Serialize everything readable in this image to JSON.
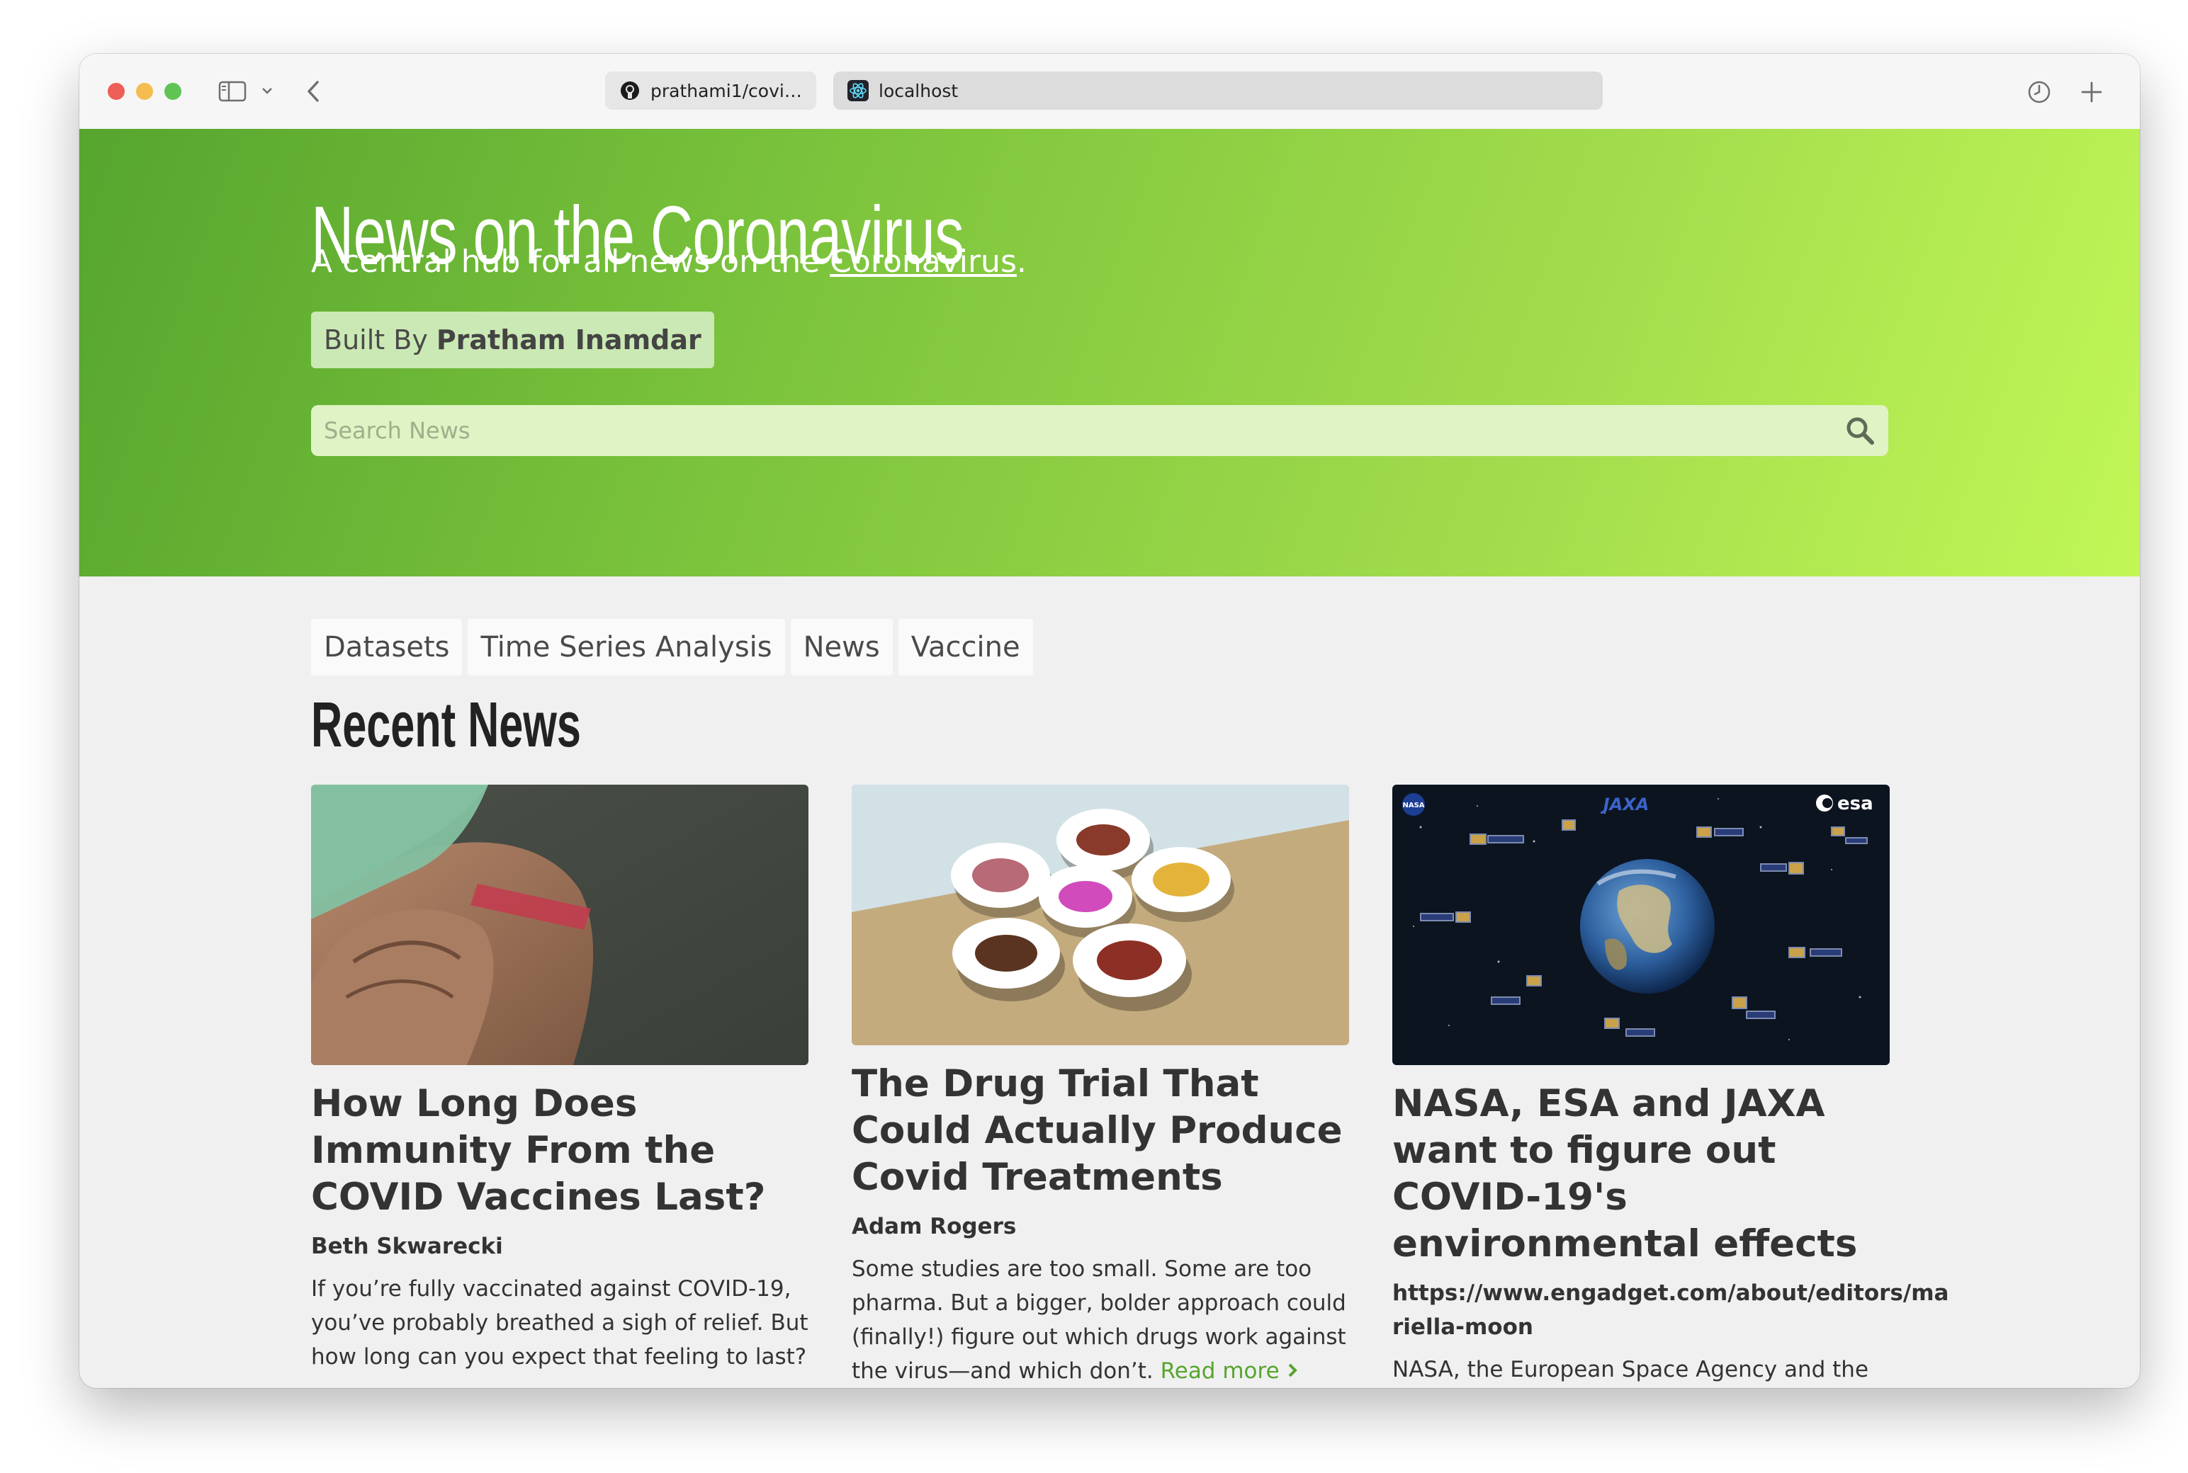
{
  "browser": {
    "tabs": [
      {
        "title": "prathami1/covid-...",
        "favicon": "github-icon"
      },
      {
        "title": "localhost",
        "favicon": "react-icon"
      }
    ]
  },
  "hero": {
    "title": "News on the Coronavirus",
    "subtitle_prefix": "A central hub for all news on the ",
    "subtitle_link": "Coronavirus",
    "subtitle_suffix": ".",
    "built_by_label": "Built By",
    "built_by_name": "Pratham Inamdar",
    "search_placeholder": "Search News"
  },
  "nav": {
    "items": [
      "Datasets",
      "Time Series Analysis",
      "News",
      "Vaccine"
    ]
  },
  "section": {
    "title": "Recent News"
  },
  "articles": [
    {
      "title": "How Long Does Immunity From the COVID Vaccines Last?",
      "author": "Beth Skwarecki",
      "description": "If you’re fully vaccinated against COVID-19, you’ve probably breathed a sigh of relief. But how long can you expect that feeling to last?",
      "image": "arm-bandage-photo"
    },
    {
      "title": "The Drug Trial That Could Actually Produce Covid Treatments",
      "author": "Adam Rogers",
      "description": "Some studies are too small. Some are too pharma. But a bigger, bolder approach could (finally!) figure out which drugs work against the virus—and which don’t.",
      "read_more": "Read more",
      "image": "pill-bowls-photo"
    },
    {
      "title": "NASA, ESA and JAXA want to figure out COVID-19's environmental effects",
      "author": "https://www.engadget.com/about/editors/mariella-moon",
      "description": "NASA, the European Space Agency and the Japan Aerospace Exploration Agency (JAXA)",
      "image": "earth-satellites-image",
      "image_labels": {
        "nasa": "NASA",
        "jaxa": "JAXA",
        "esa": "esa"
      }
    }
  ]
}
